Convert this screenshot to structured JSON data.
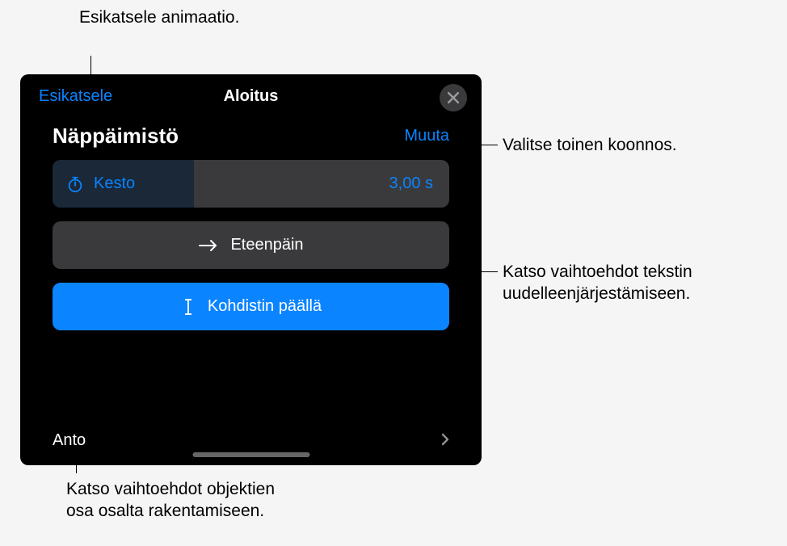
{
  "callouts": {
    "preview": "Esikatsele animaatio.",
    "change": "Valitse toinen koonnos.",
    "forward_line1": "Katso vaihtoehdot tekstin",
    "forward_line2": "uudelleenjärjestämiseen.",
    "delivery_line1": "Katso vaihtoehdot objektien",
    "delivery_line2": "osa osalta rakentamiseen."
  },
  "panel": {
    "preview_link": "Esikatsele",
    "title": "Aloitus",
    "subheader_title": "Näppäimistö",
    "change_link": "Muuta",
    "duration_label": "Kesto",
    "duration_value": "3,00  s",
    "forward_label": "Eteenpäin",
    "cursor_label": "Kohdistin päällä",
    "delivery_label": "Anto"
  }
}
